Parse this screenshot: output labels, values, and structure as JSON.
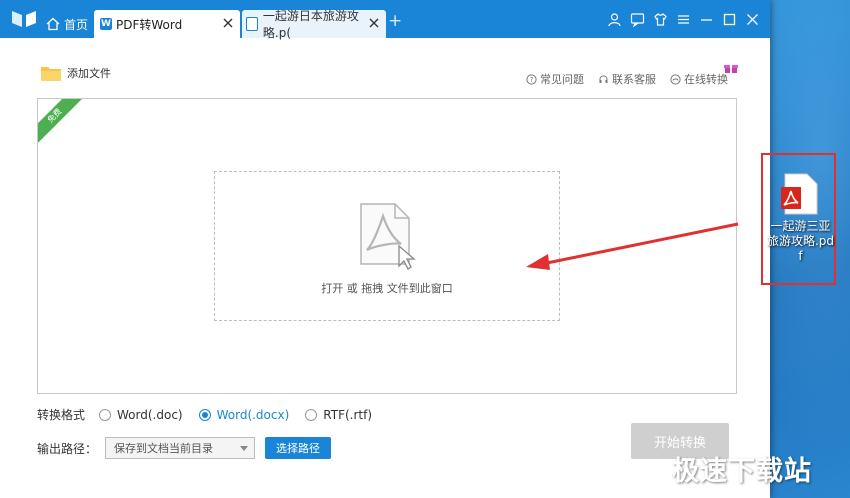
{
  "titlebar": {
    "tabs": [
      {
        "label": "首页"
      },
      {
        "label": "PDF转Word"
      },
      {
        "label": "一起游日本旅游攻略.p("
      }
    ]
  },
  "toolbar": {
    "add_file": "添加文件",
    "links": [
      "常见问题",
      "联系客服",
      "在线转换"
    ]
  },
  "drop_area": {
    "badge": "免费",
    "hint": "打开 或 拖拽 文件到此窗口"
  },
  "options": {
    "format_label": "转换格式",
    "formats": [
      {
        "label": "Word(.doc)",
        "selected": false
      },
      {
        "label": "Word(.docx)",
        "selected": true
      },
      {
        "label": "RTF(.rtf)",
        "selected": false
      }
    ],
    "path_label": "输出路径：",
    "path_value": "保存到文档当前目录",
    "choose_path": "选择路径",
    "start": "开始转换"
  },
  "desktop": {
    "file_name": "一起游三亚旅游攻略.pdf"
  },
  "watermark": "极速下载站",
  "colors": {
    "accent": "#1a85d6",
    "highlight": "#e03030",
    "badge": "#4caf50"
  }
}
